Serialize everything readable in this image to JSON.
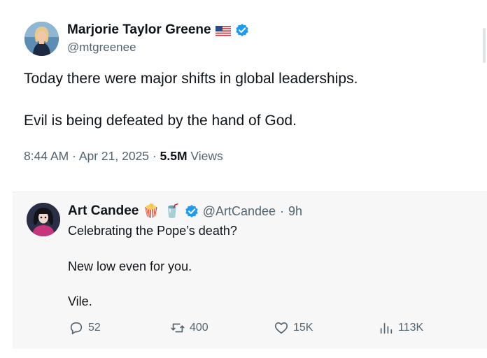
{
  "tweet": {
    "author": {
      "name": "Marjorie Taylor Greene",
      "handle": "@mtgreenee",
      "flag_icon": "us-flag-icon",
      "verified_icon": "verified-badge-icon"
    },
    "text_line_1": "Today there were major shifts in global leaderships.",
    "text_line_2": "Evil is being defeated by the hand of God.",
    "time": "8:44 AM",
    "date": "Apr 21, 2025",
    "views_count": "5.5M",
    "views_label": "Views",
    "separator": "·"
  },
  "reply": {
    "author": {
      "name": "Art Candee",
      "emoji_1": "🍿",
      "emoji_2": "🥤",
      "handle": "@ArtCandee",
      "age": "9h"
    },
    "line_1": "Celebrating the Pope’s death?",
    "line_2": "New low even for you.",
    "line_3": "Vile.",
    "actions": {
      "replies": "52",
      "reposts": "400",
      "likes": "15K",
      "views": "113K"
    }
  },
  "colors": {
    "text": "#0f1419",
    "secondary": "#536471",
    "verified": "#1d9bf0",
    "card_bg": "#f7f7f7"
  }
}
